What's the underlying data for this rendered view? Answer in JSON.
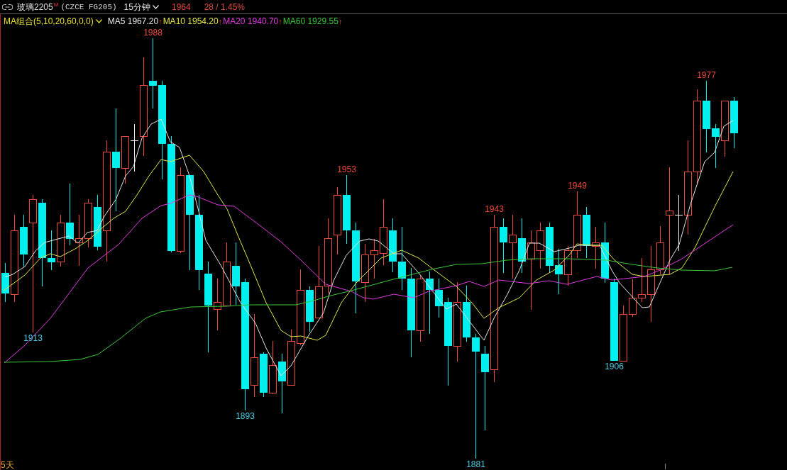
{
  "header": {
    "symbol": "玻璃2205",
    "market_badge": "M",
    "contract_code": "(CZCE FG205)",
    "period": "15分钟",
    "last_price": "1964",
    "change": "28 / 1.45%"
  },
  "indicator_legend": {
    "preset": "MA组合(5,10,20,60,0,0)",
    "lines": [
      {
        "label": "MA5 1967.20",
        "trend": "↑",
        "color": "#e6e6e6"
      },
      {
        "label": "MA10 1954.20",
        "trend": "↑",
        "color": "#e6e64a"
      },
      {
        "label": "MA20 1940.70",
        "trend": "↑",
        "color": "#e23ce2"
      },
      {
        "label": "MA60 1929.55",
        "trend": "↑",
        "color": "#3cc83c"
      }
    ]
  },
  "chart": {
    "extreme_labels": [
      {
        "text": "1913",
        "kind": "low"
      },
      {
        "text": "1988",
        "kind": "high"
      },
      {
        "text": "1893",
        "kind": "low"
      },
      {
        "text": "1953",
        "kind": "high"
      },
      {
        "text": "1881",
        "kind": "low"
      },
      {
        "text": "1943",
        "kind": "high"
      },
      {
        "text": "1949",
        "kind": "high"
      },
      {
        "text": "1906",
        "kind": "low"
      },
      {
        "text": "1977",
        "kind": "high"
      }
    ],
    "period_label": "5天"
  }
}
